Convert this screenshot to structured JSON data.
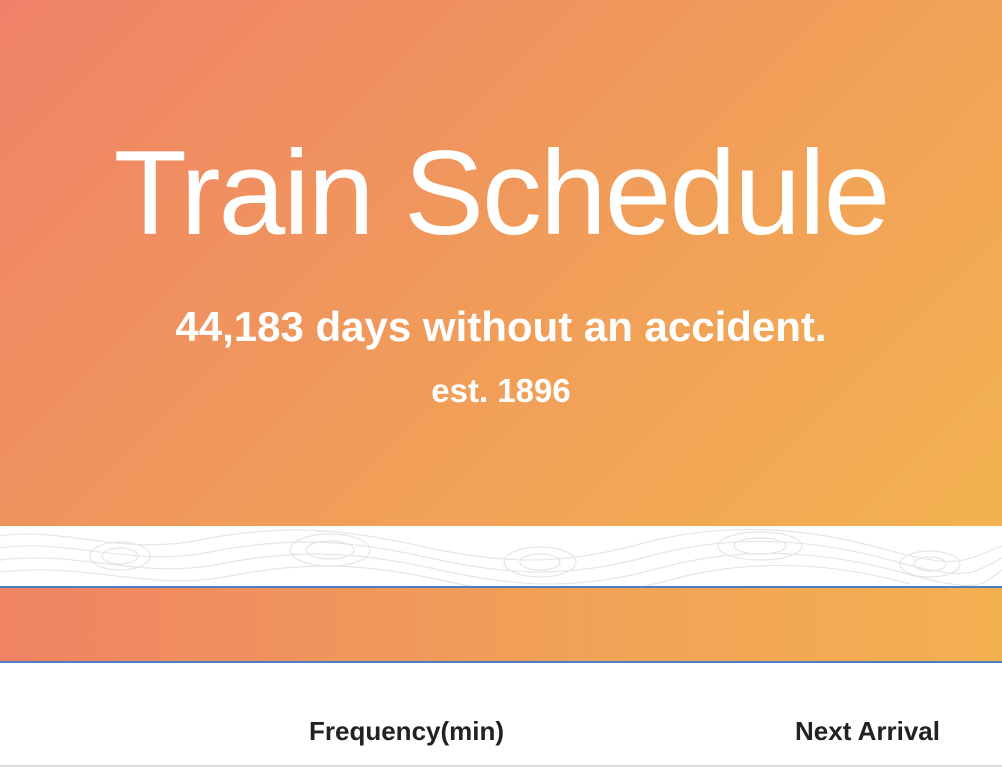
{
  "hero": {
    "title": "Train Schedule",
    "tagline": "44,183 days without an accident.",
    "established": "est. 1896"
  },
  "table": {
    "headers": [
      "Frequency(min)",
      "Next Arrival"
    ]
  },
  "colors": {
    "gradient_start": "#ef8168",
    "gradient_end": "#f3b250",
    "divider": "#4a7fc1"
  }
}
